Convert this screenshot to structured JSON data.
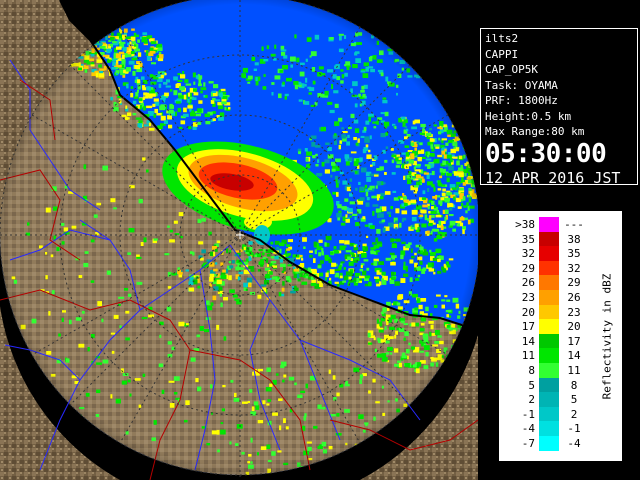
{
  "info": {
    "site": "ilts2",
    "product": "CAPPI",
    "scan": "CAP_OP5K",
    "task": "Task: OYAMA",
    "prf": "PRF: 1800Hz",
    "height": "Height:0.5 km",
    "max_range": "Max Range:80 km",
    "time": "05:30:00",
    "date": "12 APR 2016 JST"
  },
  "legend": {
    "title": "Reflectivity in dBZ",
    "rows": [
      {
        "lo": ">38",
        "hi": "---",
        "color": "#ff00ff"
      },
      {
        "lo": "35",
        "hi": "38",
        "color": "#c80000"
      },
      {
        "lo": "32",
        "hi": "35",
        "color": "#e60000"
      },
      {
        "lo": "29",
        "hi": "32",
        "color": "#ff3200"
      },
      {
        "lo": "26",
        "hi": "29",
        "color": "#ff7800"
      },
      {
        "lo": "23",
        "hi": "26",
        "color": "#ffa000"
      },
      {
        "lo": "20",
        "hi": "23",
        "color": "#ffc800"
      },
      {
        "lo": "17",
        "hi": "20",
        "color": "#ffff00"
      },
      {
        "lo": "14",
        "hi": "17",
        "color": "#00c800"
      },
      {
        "lo": "11",
        "hi": "14",
        "color": "#00e600"
      },
      {
        "lo": "8",
        "hi": "11",
        "color": "#32ff32"
      },
      {
        "lo": "5",
        "hi": "8",
        "color": "#00a0a0"
      },
      {
        "lo": "2",
        "hi": "5",
        "color": "#00b4b4"
      },
      {
        "lo": "-1",
        "hi": "2",
        "color": "#00c8c8"
      },
      {
        "lo": "-4",
        "hi": "-1",
        "color": "#00e0e0"
      },
      {
        "lo": "-7",
        "hi": "-4",
        "color": "#00ffff"
      }
    ]
  },
  "colors": {
    "ocean_coverage": "#0050ff",
    "land": "#7a6548",
    "coast": "#000000",
    "rivers": "#2828ff",
    "boundaries": "#b40000"
  }
}
